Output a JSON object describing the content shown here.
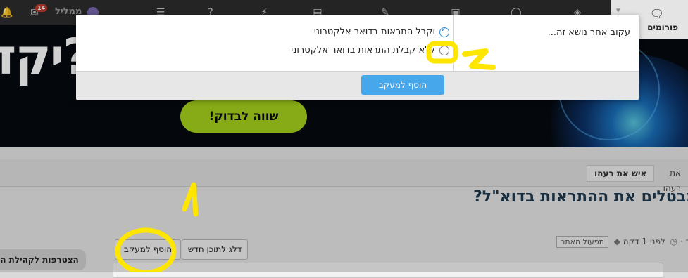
{
  "topbar": {
    "user_name": "ממליל",
    "mail_badge": "14",
    "forums_tab": "פורומים",
    "icons": [
      "bell-icon",
      "mail-icon",
      "avatar",
      "list-icon",
      "question-icon",
      "bolt-icon",
      "news-icon",
      "pen-icon",
      "camera-icon",
      "chat-icon",
      "shield-icon",
      "forum-chat-icon"
    ]
  },
  "banner": {
    "headline": "?יקד",
    "cta_label": "שווה לבדוק!"
  },
  "breadcrumb": {
    "previous": "את רעהו",
    "current": "איש את רעהו"
  },
  "thread": {
    "title": "מבטלים את ההתראות בדוא\"ל?",
    "meta_time": "לפני 1 דקה",
    "meta_author_fragment": "ך",
    "meta_tag": "תפעול האתר"
  },
  "actions": {
    "skip_label": "דלג לתוכן חדש",
    "watch_label": "הוסף למעקב",
    "join_label": "הצטרפות לקהילת ה"
  },
  "popup": {
    "title": "עקוב אחר נושא זה...",
    "option_email": "וקבל התראות בדואר אלקטרוני",
    "option_no_email": "ללא קבלת התראות בדואר אלקטרוני",
    "submit_label": "הוסף למעקב"
  },
  "annotations": {
    "step1": "1",
    "step2": "2"
  },
  "colors": {
    "accent_blue": "#47a7eb",
    "cta_green": "#a5d11d",
    "annotation_yellow": "#ffe600",
    "topbar_dark": "#2d2d2d"
  }
}
